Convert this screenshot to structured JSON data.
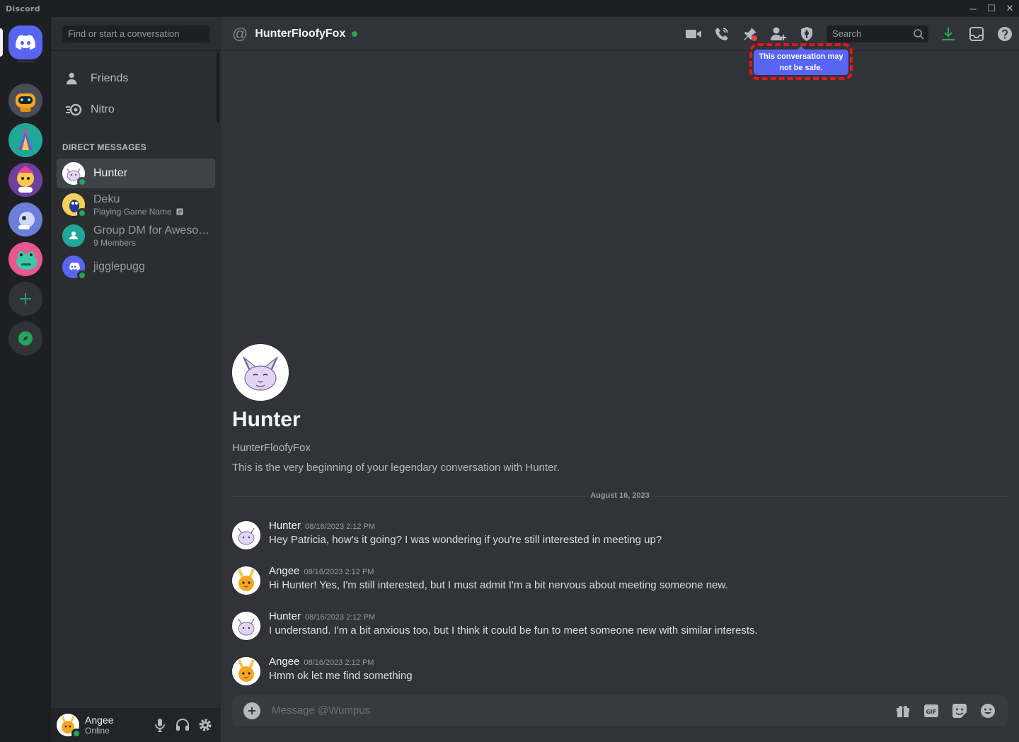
{
  "window": {
    "brand": "Discord",
    "minimize_glyph": "─",
    "maximize_glyph": "☐",
    "close_glyph": "✕"
  },
  "sidebar": {
    "search_placeholder": "Find or start a conversation",
    "nav": [
      {
        "label": "Friends",
        "icon": "friends-icon"
      },
      {
        "label": "Nitro",
        "icon": "nitro-icon"
      }
    ],
    "dm_header": "DIRECT MESSAGES",
    "dms": [
      {
        "name": "Hunter",
        "sub": "",
        "active": true,
        "online": true
      },
      {
        "name": "Deku",
        "sub": "Playing Game Name",
        "active": false,
        "online": true
      },
      {
        "name": "Group DM for Awesom...",
        "sub": "9 Members",
        "active": false,
        "online": false
      },
      {
        "name": "jigglepugg",
        "sub": "",
        "active": false,
        "online": true
      }
    ]
  },
  "user_panel": {
    "name": "Angee",
    "status": "Online"
  },
  "header": {
    "channel_name": "HunterFloofyFox",
    "search_placeholder": "Search",
    "tooltip": "This conversation may not be safe."
  },
  "welcome": {
    "name": "Hunter",
    "username": "HunterFloofyFox",
    "intro": "This is the very beginning of your legendary conversation with Hunter."
  },
  "date_divider": "August 16, 2023",
  "messages": [
    {
      "author": "Hunter",
      "time": "08/16/2023 2:12 PM",
      "text": "Hey Patricia, how's it going? I was wondering if you're still interested in meeting up?"
    },
    {
      "author": "Angee",
      "time": "08/16/2023 2:12 PM",
      "text": "Hi Hunter! Yes, I'm still interested, but I must admit I'm a bit nervous about meeting someone new."
    },
    {
      "author": "Hunter",
      "time": "08/16/2023 2:12 PM",
      "text": "I understand. I'm a bit anxious too, but I think it could be fun to meet someone new with similar interests."
    },
    {
      "author": "Angee",
      "time": "08/16/2023 2:12 PM",
      "text": "Hmm ok let me find something"
    }
  ],
  "composer": {
    "placeholder": "Message @Wumpus",
    "gif_label": "GIF"
  },
  "colors": {
    "blurple": "#5865f2",
    "online_green": "#23a55a",
    "highlight_red": "#e8141c"
  }
}
